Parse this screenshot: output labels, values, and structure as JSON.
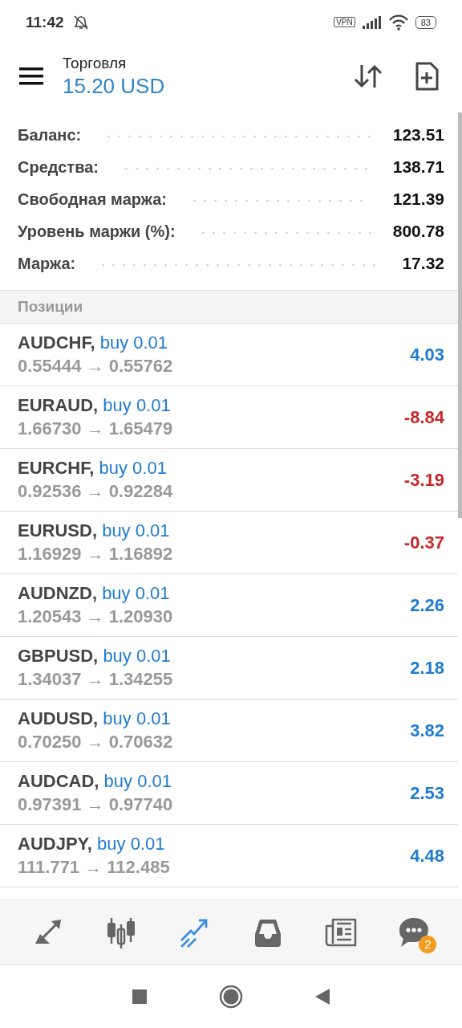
{
  "status_bar": {
    "time": "11:42",
    "vpn": "VPN",
    "battery": "83"
  },
  "header": {
    "title": "Торговля",
    "balance": "15.20 USD"
  },
  "summary": [
    {
      "label": "Баланс:",
      "value": "123.51"
    },
    {
      "label": "Средства:",
      "value": "138.71"
    },
    {
      "label": "Свободная маржа:",
      "value": "121.39"
    },
    {
      "label": "Уровень маржи (%):",
      "value": "800.78"
    },
    {
      "label": "Маржа:",
      "value": "17.32"
    }
  ],
  "section": "Позиции",
  "positions": [
    {
      "symbol": "AUDCHF,",
      "order": "buy 0.01",
      "prices": "0.55444 → 0.55762",
      "profit": "4.03",
      "color": "#1e7bd0"
    },
    {
      "symbol": "EURAUD,",
      "order": "buy 0.01",
      "prices": "1.66730 → 1.65479",
      "profit": "-8.84",
      "color": "#c62828"
    },
    {
      "symbol": "EURCHF,",
      "order": "buy 0.01",
      "prices": "0.92536 → 0.92284",
      "profit": "-3.19",
      "color": "#c62828"
    },
    {
      "symbol": "EURUSD,",
      "order": "buy 0.01",
      "prices": "1.16929 → 1.16892",
      "profit": "-0.37",
      "color": "#c62828"
    },
    {
      "symbol": "AUDNZD,",
      "order": "buy 0.01",
      "prices": "1.20543 → 1.20930",
      "profit": "2.26",
      "color": "#1e7bd0"
    },
    {
      "symbol": "GBPUSD,",
      "order": "buy 0.01",
      "prices": "1.34037 → 1.34255",
      "profit": "2.18",
      "color": "#1e7bd0"
    },
    {
      "symbol": "AUDUSD,",
      "order": "buy 0.01",
      "prices": "0.70250 → 0.70632",
      "profit": "3.82",
      "color": "#1e7bd0"
    },
    {
      "symbol": "AUDCAD,",
      "order": "buy 0.01",
      "prices": "0.97391 → 0.97740",
      "profit": "2.53",
      "color": "#1e7bd0"
    },
    {
      "symbol": "AUDJPY,",
      "order": "buy 0.01",
      "prices": "111.771 → 112.485",
      "profit": "4.48",
      "color": "#1e7bd0"
    }
  ],
  "bottom_nav": [
    {
      "kind": "quotes",
      "selected": false
    },
    {
      "kind": "chart",
      "selected": false
    },
    {
      "kind": "trade",
      "selected": true
    },
    {
      "kind": "history",
      "selected": false
    },
    {
      "kind": "news",
      "selected": false
    },
    {
      "kind": "chat",
      "selected": false,
      "badge": "2"
    }
  ]
}
